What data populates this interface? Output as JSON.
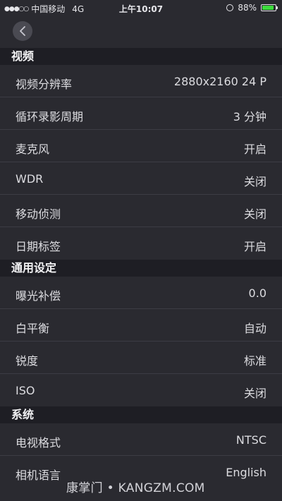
{
  "status_bar": {
    "signal": "●●●○○",
    "carrier": "中国移动",
    "network": "4G",
    "time": "上午10:07",
    "battery_percent": "88%",
    "battery_level": 0.88,
    "battery_color": "#3ddc3d"
  },
  "nav": {
    "back_icon": "chevron-left-icon"
  },
  "sections": [
    {
      "title": "视频",
      "rows": [
        {
          "label": "视频分辨率",
          "value": "2880x2160 24 P"
        },
        {
          "label": "循环录影周期",
          "value": "3 分钟"
        },
        {
          "label": "麦克风",
          "value": "开启"
        },
        {
          "label": "WDR",
          "value": "关闭"
        },
        {
          "label": "移动侦测",
          "value": "关闭"
        },
        {
          "label": "日期标签",
          "value": "开启"
        }
      ]
    },
    {
      "title": "通用设定",
      "rows": [
        {
          "label": "曝光补偿",
          "value": "0.0"
        },
        {
          "label": "白平衡",
          "value": "自动"
        },
        {
          "label": "锐度",
          "value": "标准"
        },
        {
          "label": "ISO",
          "value": "关闭"
        }
      ]
    },
    {
      "title": "系统",
      "rows": [
        {
          "label": "电视格式",
          "value": "NTSC"
        },
        {
          "label": "相机语言",
          "value": "English"
        }
      ]
    }
  ],
  "watermark": "康掌门 • KANGZM.COM"
}
